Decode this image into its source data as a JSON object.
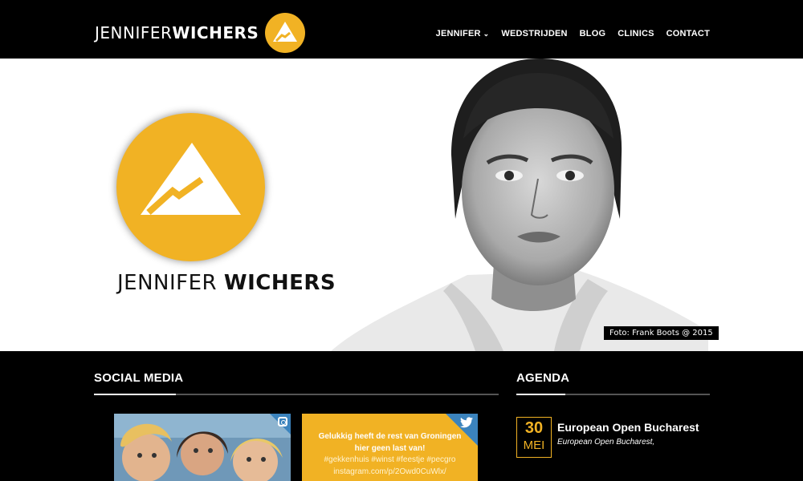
{
  "header": {
    "logo": {
      "light": "JENNIFER",
      "bold": "WICHERS"
    },
    "nav": [
      {
        "label": "JENNIFER",
        "has_dropdown": true
      },
      {
        "label": "WEDSTRIJDEN"
      },
      {
        "label": "BLOG"
      },
      {
        "label": "CLINICS"
      },
      {
        "label": "CONTACT"
      }
    ]
  },
  "hero": {
    "name_light": "JENNIFER",
    "name_bold": "WICHERS",
    "photo_credit": "Foto: Frank Boots @ 2015"
  },
  "social": {
    "title": "SOCIAL MEDIA",
    "tweet": {
      "line_bold": "Gelukkig heeft de rest van Groningen hier geen last van!",
      "hashtags": "#gekkenhuis #winst #feestje #pecgro",
      "link": "instagram.com/p/2Owd0CuWlx/"
    }
  },
  "agenda": {
    "title": "AGENDA",
    "events": [
      {
        "day": "30",
        "month": "MEI",
        "title": "European Open Bucharest",
        "subtitle": "European Open Bucharest,"
      }
    ]
  },
  "colors": {
    "accent": "#f1b224",
    "background": "#000000",
    "twitter_blue": "#3b83bd"
  },
  "icons": [
    "mountain-logo-icon",
    "chevron-down-icon",
    "instagram-icon",
    "twitter-icon"
  ]
}
